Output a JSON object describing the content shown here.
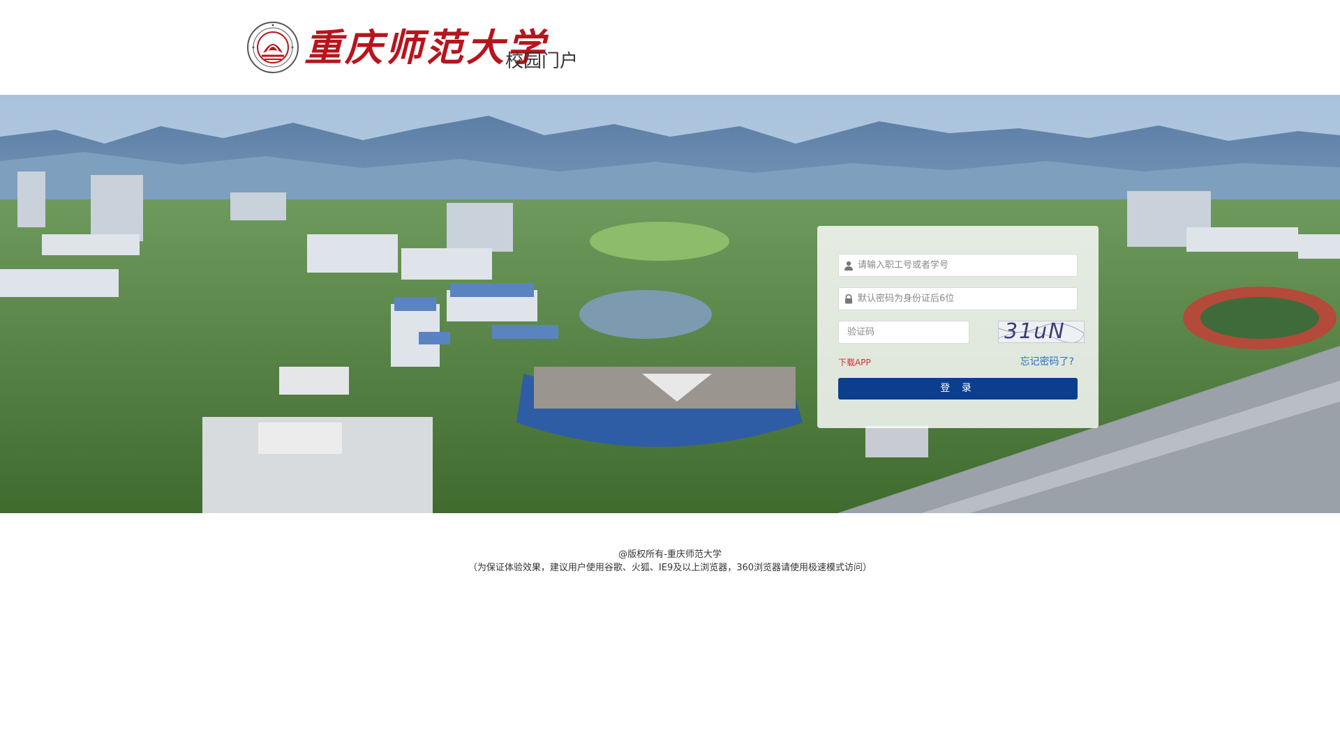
{
  "header": {
    "university_name": "重庆师范大学",
    "portal_title": "校园门户",
    "emblem_icon": "university-seal-icon",
    "brand_color": "#b8141d"
  },
  "login": {
    "username_placeholder": "请输入职工号或者学号",
    "password_placeholder": "默认密码为身份证后6位",
    "captcha_placeholder": "验证码",
    "captcha_text": "31uN",
    "download_app_label": "下载APP",
    "forgot_password_label": "忘记密码了?",
    "login_button_label": "登 录",
    "user_icon": "user-icon",
    "lock_icon": "lock-icon",
    "button_color": "#0b3f8e",
    "download_color": "#e0282e",
    "link_color": "#2d6fc0"
  },
  "footer": {
    "copyright": "@版权所有-重庆师范大学",
    "browser_note": "（为保证体验效果，建议用户使用谷歌、火狐、IE9及以上浏览器，360浏览器请使用极速模式访问）"
  }
}
